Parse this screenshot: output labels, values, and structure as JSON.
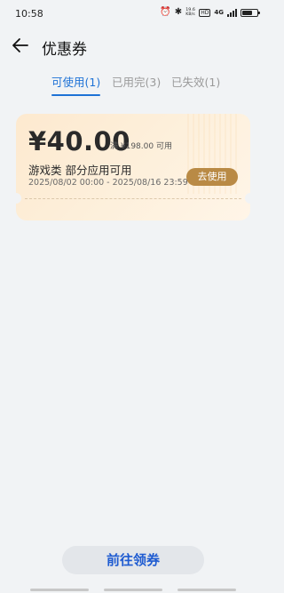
{
  "status_bar": {
    "time": "10:58",
    "net_speed_value": "19.6",
    "net_speed_unit": "KB/s",
    "hd_label": "HD",
    "network_label": "4G",
    "battery_level": 0.7
  },
  "header": {
    "title": "优惠券"
  },
  "tabs": [
    {
      "label": "可使用(1)",
      "active": true
    },
    {
      "label": "已用完(3)",
      "active": false
    },
    {
      "label": "已失效(1)",
      "active": false
    }
  ],
  "coupon": {
    "amount": "¥40.00",
    "threshold": "满 ¥198.00 可用",
    "scope": "游戏类 部分应用可用",
    "validity": "2025/08/02 00:00 - 2025/08/16 23:59",
    "action_label": "去使用"
  },
  "bottom_button": {
    "label": "前往领券"
  },
  "colors": {
    "accent": "#1e72d6",
    "coupon_button": "#b98a45",
    "coupon_bg": "#fde9cf"
  }
}
